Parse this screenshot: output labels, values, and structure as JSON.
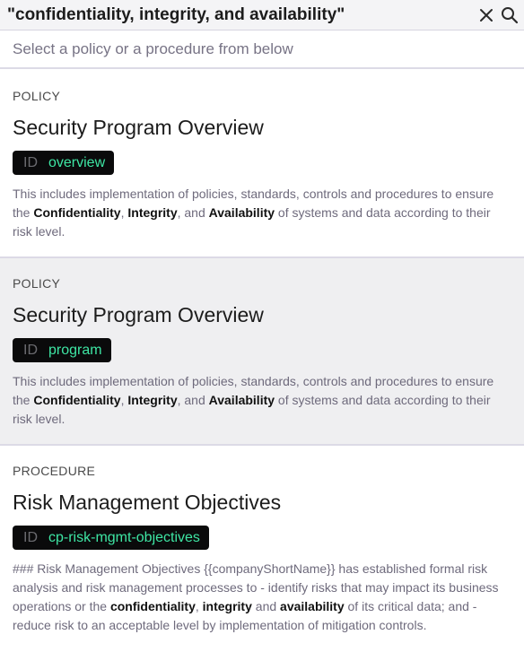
{
  "search": {
    "query": "\"confidentiality, integrity, and availability\"",
    "clear_icon": "close-icon",
    "search_icon": "search-icon"
  },
  "subheader": "Select a policy or a procedure from below",
  "results": [
    {
      "kind": "POLICY",
      "title": "Security Program Overview",
      "id_label": "ID",
      "id_value": "overview",
      "excerpt": [
        {
          "t": "This includes implementation of policies, standards, controls and procedures to ensure the ",
          "b": false
        },
        {
          "t": "Confidentiality",
          "b": true
        },
        {
          "t": ", ",
          "b": false
        },
        {
          "t": "Integrity",
          "b": true
        },
        {
          "t": ", and ",
          "b": false
        },
        {
          "t": "Availability",
          "b": true
        },
        {
          "t": " of systems and data according to their risk level.",
          "b": false
        }
      ]
    },
    {
      "kind": "POLICY",
      "title": "Security Program Overview",
      "id_label": "ID",
      "id_value": "program",
      "excerpt": [
        {
          "t": "This includes implementation of policies, standards, controls and procedures to ensure the ",
          "b": false
        },
        {
          "t": "Confidentiality",
          "b": true
        },
        {
          "t": ", ",
          "b": false
        },
        {
          "t": "Integrity",
          "b": true
        },
        {
          "t": ", and ",
          "b": false
        },
        {
          "t": "Availability",
          "b": true
        },
        {
          "t": " of systems and data according to their risk level.",
          "b": false
        }
      ]
    },
    {
      "kind": "PROCEDURE",
      "title": "Risk Management Objectives",
      "id_label": "ID",
      "id_value": "cp-risk-mgmt-objectives",
      "excerpt": [
        {
          "t": "### Risk Management Objectives {{companyShortName}} has established formal risk analysis and risk management processes to - identify risks that may impact its business operations or the ",
          "b": false
        },
        {
          "t": "confidentiality",
          "b": true
        },
        {
          "t": ", ",
          "b": false
        },
        {
          "t": "integrity",
          "b": true
        },
        {
          "t": " and ",
          "b": false
        },
        {
          "t": "availability",
          "b": true
        },
        {
          "t": " of its critical data; and - reduce risk to an acceptable level by implementation of mitigation controls.",
          "b": false
        }
      ]
    }
  ]
}
